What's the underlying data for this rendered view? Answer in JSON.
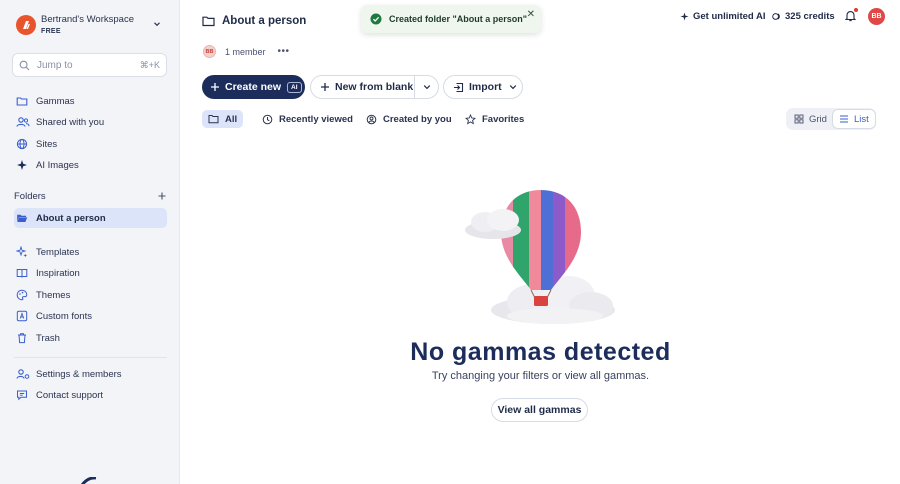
{
  "workspace": {
    "name": "Bertrand's Workspace",
    "plan": "FREE"
  },
  "search": {
    "placeholder": "Jump to",
    "shortcut": "⌘+K"
  },
  "sidebar": {
    "primary": [
      {
        "label": "Gammas",
        "icon": "folder-icon"
      },
      {
        "label": "Shared with you",
        "icon": "users-icon"
      },
      {
        "label": "Sites",
        "icon": "globe-icon"
      },
      {
        "label": "AI Images",
        "icon": "sparkle-icon"
      }
    ],
    "folders_header": "Folders",
    "folders": [
      {
        "label": "About a person",
        "icon": "folder-open-icon"
      }
    ],
    "secondary": [
      {
        "label": "Templates",
        "icon": "sparkle-icon"
      },
      {
        "label": "Inspiration",
        "icon": "book-icon"
      },
      {
        "label": "Themes",
        "icon": "palette-icon"
      },
      {
        "label": "Custom fonts",
        "icon": "font-icon"
      },
      {
        "label": "Trash",
        "icon": "trash-icon"
      }
    ],
    "footer": [
      {
        "label": "Settings & members",
        "icon": "settings-users-icon"
      },
      {
        "label": "Contact support",
        "icon": "chat-icon"
      }
    ]
  },
  "page": {
    "title": "About a person",
    "members": "1 member",
    "member_initials": "BB"
  },
  "toolbar": {
    "create_new": "Create new",
    "ai_badge": "AI",
    "new_from_blank": "New from blank",
    "import": "Import"
  },
  "filters": [
    {
      "label": "All",
      "active": true
    },
    {
      "label": "Recently viewed"
    },
    {
      "label": "Created by you"
    },
    {
      "label": "Favorites"
    }
  ],
  "view": {
    "grid": "Grid",
    "list": "List",
    "selected": "List"
  },
  "toast": {
    "message": "Created folder \"About a person\""
  },
  "header": {
    "unlimited_ai": "Get unlimited AI",
    "credits": "325 credits",
    "avatar_initials": "BB"
  },
  "empty_state": {
    "title": "No gammas detected",
    "subtitle": "Try changing your filters or view all gammas.",
    "button": "View all gammas"
  },
  "colors": {
    "primary": "#1c2d5c",
    "accent": "#3a5fcd",
    "active_bg": "#dbe4f8",
    "brand": "#e8552d",
    "avatar": "#e04848"
  }
}
